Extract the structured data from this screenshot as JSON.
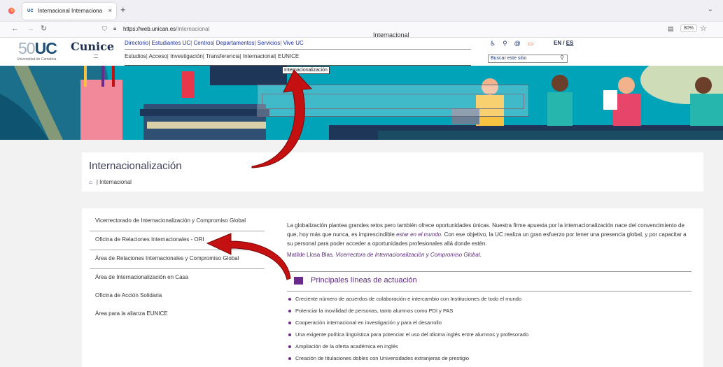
{
  "browser": {
    "tab_title": "Internacional Internacionalizaci",
    "tab_favicon": "UC",
    "url_host": "https://web.unican.es",
    "url_path": "/Internacional",
    "zoom": "80%"
  },
  "header": {
    "logo_number": "50",
    "logo_text": "UC",
    "logo_sub": "Universidad de Cantabria",
    "cunice": "Cunice",
    "top_links": [
      "Directorio",
      "Estudiantes UC",
      "Centros",
      "Departamentos",
      "Servicios",
      "Vive UC"
    ],
    "sub_links": [
      "Estudios",
      "Acceso",
      "Investigación",
      "Transferencia",
      "Internacional",
      "EUNICE"
    ],
    "lang_en": "EN",
    "lang_es": "ES",
    "search_placeholder": "Buscar este sitio"
  },
  "banner": {
    "title": "Internacional",
    "tooltip": "Internacionalización"
  },
  "page": {
    "title": "Internacionalización",
    "breadcrumb": "| Internacional"
  },
  "sidebar": {
    "items": [
      "Vicerrectorado de Internacionalización y Compromiso Global",
      "Oficina de Relaciones Internacionales - ORI",
      "Área de Relaciones Internacionales y Compromiso Global",
      "Área de Internacionalización en Casa",
      "Oficina de Acción Solidaria",
      "Área para la alianza EUNICE"
    ]
  },
  "main": {
    "intro_a": "La globalización plantea grandes retos pero también ofrece oportunidades únicas. Nuestra firme apuesta por la internacionalización nace del convencimiento de que, hoy más que nunca, es imprescindible ",
    "intro_em": "estar en el mundo",
    "intro_b": ". Con ese objetivo, la UC realiza un gran esfuerzo por tener una presencia global, y por capacitar a su personal para poder acceder a oportunidades profesionales allá donde estén.",
    "author": "Matilde Llosa Blas",
    "author_role": ", Vicerrectora de Internacionalización y Compromiso Global.",
    "section_title": "Principales líneas de actuación",
    "bullets": [
      "Creciente número de acuerdos de colaboración e intercambio con Instituciones de todo el mundo",
      "Potenciar la movilidad de personas, tanto alumnos como PDI y PAS",
      "Cooperación internacional en investigación y para el desarrollo",
      "Una exigente política lingüística para potenciar el uso del idioma inglés entre alumnos y profesorado",
      "Ampliación de la oferta académica en inglés",
      "Creación de titulaciones dobles con Universidades extranjeras de prestigio"
    ]
  },
  "colors": {
    "accent": "#6a2a8a",
    "banner": "#00a3b7",
    "arrow": "#c41010"
  }
}
